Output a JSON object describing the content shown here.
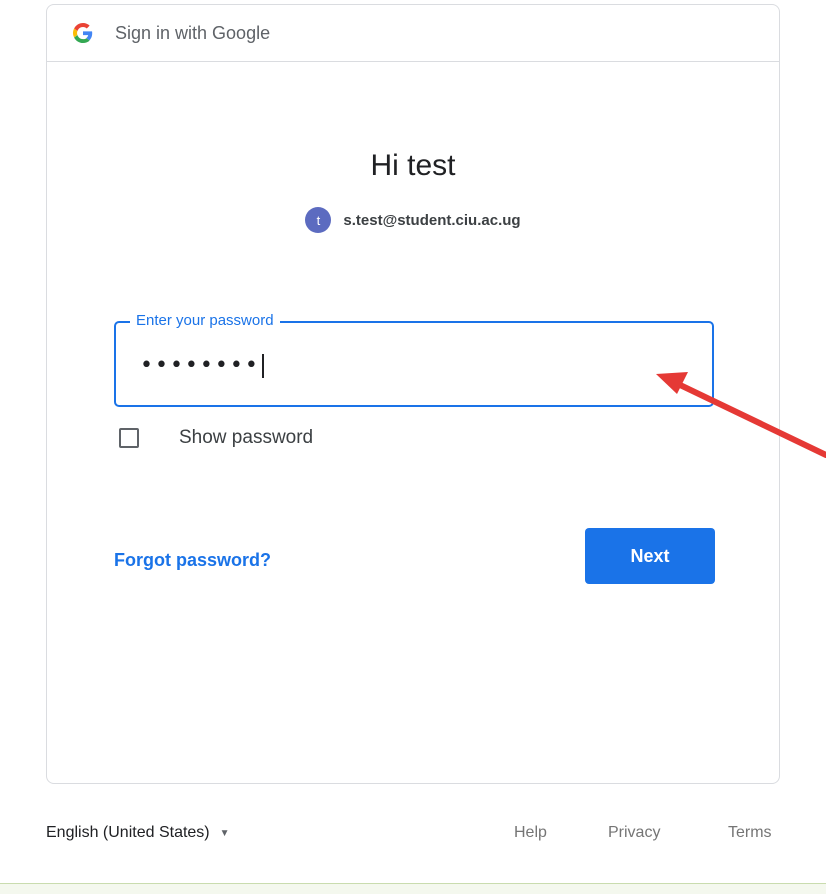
{
  "header": {
    "google_icon": "google-g-icon",
    "label": "Sign in with Google"
  },
  "main": {
    "title": "Hi test",
    "account": {
      "avatar_letter": "t",
      "email": "s.test@student.ciu.ac.ug"
    },
    "password": {
      "label": "Enter your password",
      "value": "••••••••"
    },
    "show_password_label": "Show password",
    "forgot_label": "Forgot password?",
    "next_label": "Next"
  },
  "footer": {
    "language": "English (United States)",
    "links": {
      "help": "Help",
      "privacy": "Privacy",
      "terms": "Terms"
    }
  },
  "colors": {
    "accent": "#1a73e8",
    "avatar": "#5c6bc0",
    "annotation_arrow": "#e53935"
  }
}
